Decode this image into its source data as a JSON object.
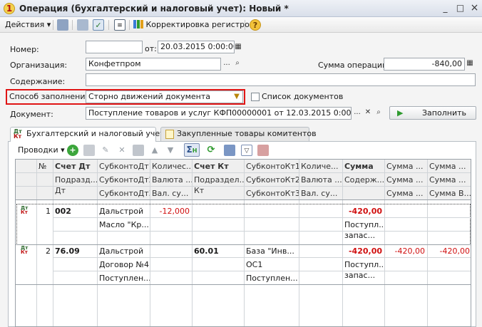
{
  "window": {
    "title": "Операция (бухгалтерский и налоговый учет): Новый *",
    "minimize_glyph": "_",
    "maximize_glyph": "□",
    "close_glyph": "×",
    "app_icon_glyph": "1"
  },
  "toolbar": {
    "actions_label": "Действия",
    "actions_caret": "▾",
    "registers_label": "Корректировка регистров",
    "help_glyph": "?"
  },
  "form": {
    "number_label": "Номер:",
    "number_value": "",
    "date_label": "от:",
    "date_value": "20.03.2015  0:00:00",
    "org_label": "Организация:",
    "org_value": "Конфетпром",
    "sum_label": "Сумма операции:",
    "sum_value": "-840,00",
    "content_label": "Содержание:",
    "content_value": "",
    "fill_method_label": "Способ заполнения:",
    "fill_method_value": "Сторно движений документа",
    "doc_list_label": "Список документов",
    "doc_list_checked": false,
    "document_label": "Документ:",
    "document_value": "Поступление товаров и услуг КФП00000001 от 12.03.2015 0:00:00",
    "fill_button_label": "Заполнить",
    "ellipsis": "...",
    "search_glyph": "⌕",
    "clear_glyph": "✕"
  },
  "tabs": [
    {
      "label": "Бухгалтерский и налоговый учет",
      "icon": "dt-kt-icon",
      "icon_dt": "Дт",
      "icon_kt": "Кт",
      "active": true
    },
    {
      "label": "Закупленные товары комитентов",
      "icon": "document-icon",
      "active": false
    }
  ],
  "grid_toolbar": {
    "postings_label": "Проводки",
    "sum_glyph": "Σ",
    "sum_sub": "H"
  },
  "grid": {
    "header_rows": [
      [
        "",
        "№",
        "Счет Дт",
        "СубконтоДт1",
        "Количес...",
        "Счет Кт",
        "СубконтоКт1",
        "Количе...",
        "Сумма",
        "Сумма ...",
        "Сумма ..."
      ],
      [
        "",
        "",
        "Подразд... Дт",
        "СубконтоДт2",
        "Валюта ...",
        "Подраздел... Кт",
        "СубконтоКт2",
        "Валюта ...",
        "Содерж...",
        "Сумма ...",
        "Сумма ..."
      ],
      [
        "",
        "",
        "",
        "СубконтоДт3",
        "Вал. су...",
        "",
        "СубконтоКт3",
        "Вал. су...",
        "",
        "Сумма ...",
        "Сумма В..."
      ]
    ],
    "rows": [
      {
        "icon_dt": "Дт",
        "icon_kt": "Кт",
        "number": "1",
        "account_dt": "002",
        "dt1": "Дальстрой",
        "qty_dt": "-12,000",
        "dt2": "Масло \"Кр...",
        "account_kt": "",
        "kt1": "",
        "kt2": "",
        "kt3": "",
        "sum": "-420,00",
        "content_1": "Поступл...",
        "content_2": "запас...",
        "sum_a": "",
        "sum_b": ""
      },
      {
        "icon_dt": "Дт",
        "icon_kt": "Кт",
        "number": "2",
        "account_dt": "76.09",
        "dt1": "Дальстрой",
        "qty_dt": "",
        "dt2": "Договор №4",
        "dt3": "Поступлен...",
        "account_kt": "60.01",
        "kt1": "База \"Инв...",
        "kt2": "ОС1",
        "kt3": "Поступлен...",
        "sum": "-420,00",
        "content_1": "Поступл...",
        "content_2": "запас...",
        "sum_a": "-420,00",
        "sum_b": "-420,00"
      }
    ]
  },
  "colors": {
    "highlight": "#e01515",
    "negative": "#d01010",
    "accent_green": "#2e9a2e"
  }
}
